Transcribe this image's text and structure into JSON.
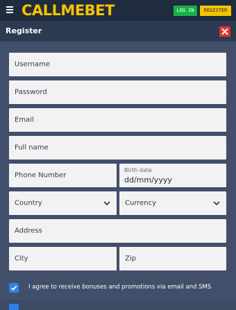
{
  "topbar": {
    "logo_text": "CALLMEBET",
    "login_label": "LOG IN",
    "register_label": "REGISTER",
    "colors": {
      "brand": "#f5c400",
      "login": "#17b14a",
      "bar": "#1f2b3e"
    }
  },
  "header": {
    "title": "Register"
  },
  "form": {
    "username": "Username",
    "password": "Password",
    "email": "Email",
    "full_name": "Full name",
    "phone": "Phone Number",
    "birth_date_label": "Birth date",
    "birth_date_value": "dd/mm/yyyy",
    "country": "Country",
    "currency": "Currency",
    "address": "Address",
    "city": "City",
    "zip": "Zip"
  },
  "consent": {
    "label": "I agree to receive bonuses and promotions via email and SMS",
    "checked": true
  },
  "icons": {
    "menu": "hamburger-icon",
    "close": "close-icon",
    "dropdown": "chevron-down-icon",
    "check": "checkmark-icon"
  }
}
